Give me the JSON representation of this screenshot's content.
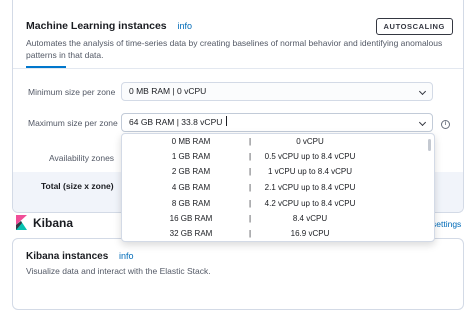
{
  "ml": {
    "title": "Machine Learning instances",
    "info": "info",
    "badge": "AUTOSCALING",
    "description": "Automates the analysis of time-series data by creating baselines of normal behavior and identifying anomalous patterns in that data.",
    "min_label": "Minimum size per zone",
    "min_value": "0 MB RAM | 0 vCPU",
    "max_label": "Maximum size per zone",
    "max_value": "64 GB RAM | 33.8 vCPU",
    "zones_label": "Availability zones",
    "total_label": "Total (size x zone)",
    "info_icon": "i"
  },
  "dropdown": {
    "separator": "|",
    "options": [
      {
        "ram": "0 MB RAM",
        "cpu": "0 vCPU"
      },
      {
        "ram": "1 GB RAM",
        "cpu": "0.5 vCPU up to 8.4 vCPU"
      },
      {
        "ram": "2 GB RAM",
        "cpu": "1 vCPU up to 8.4 vCPU"
      },
      {
        "ram": "4 GB RAM",
        "cpu": "2.1 vCPU up to 8.4 vCPU"
      },
      {
        "ram": "8 GB RAM",
        "cpu": "4.2 vCPU up to 8.4 vCPU"
      },
      {
        "ram": "16 GB RAM",
        "cpu": "8.4 vCPU"
      },
      {
        "ram": "32 GB RAM",
        "cpu": "16.9 vCPU"
      }
    ]
  },
  "kibana": {
    "name": "Kibana",
    "settings": "settings",
    "title": "Kibana instances",
    "info": "info",
    "description": "Visualize data and interact with the Elastic Stack."
  },
  "colors": {
    "accent": "#0077cc",
    "link": "#006bb8",
    "kibana_pink": "#f04e98",
    "kibana_teal": "#07c1b0"
  }
}
